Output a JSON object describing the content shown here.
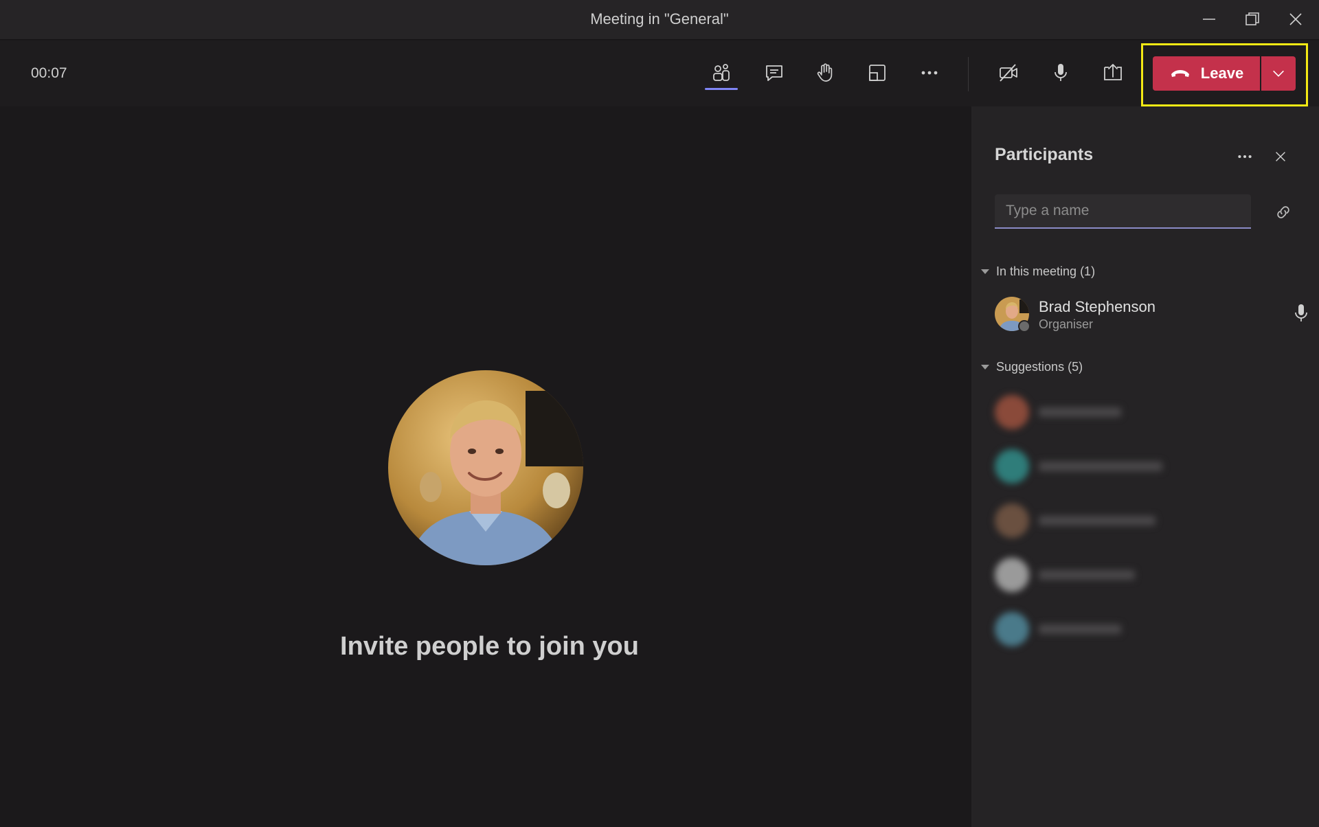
{
  "window": {
    "title": "Meeting in \"General\""
  },
  "toolbar": {
    "timer": "00:07",
    "leave_label": "Leave",
    "icons": [
      "people-icon",
      "chat-icon",
      "raise-hand-icon",
      "room-icon",
      "more-icon",
      "camera-off-icon",
      "mic-icon",
      "share-icon"
    ]
  },
  "stage": {
    "invite_text": "Invite people to join you"
  },
  "participants": {
    "title": "Participants",
    "search_placeholder": "Type a name",
    "in_meeting_header": "In this meeting (1)",
    "members": [
      {
        "name": "Brad Stephenson",
        "role": "Organiser"
      }
    ],
    "suggestions_header": "Suggestions (5)",
    "suggestions": [
      {
        "name": "",
        "avatar_color": "#8a4a3a"
      },
      {
        "name": "",
        "avatar_color": "#2f7d7a"
      },
      {
        "name": "",
        "avatar_color": "#6a5040"
      },
      {
        "name": "",
        "avatar_color": "#9a9a9a"
      },
      {
        "name": "",
        "avatar_color": "#4a7a8a"
      }
    ]
  },
  "colors": {
    "accent": "#7f85f5",
    "leave": "#c4314b",
    "highlight": "#f5ea14"
  }
}
